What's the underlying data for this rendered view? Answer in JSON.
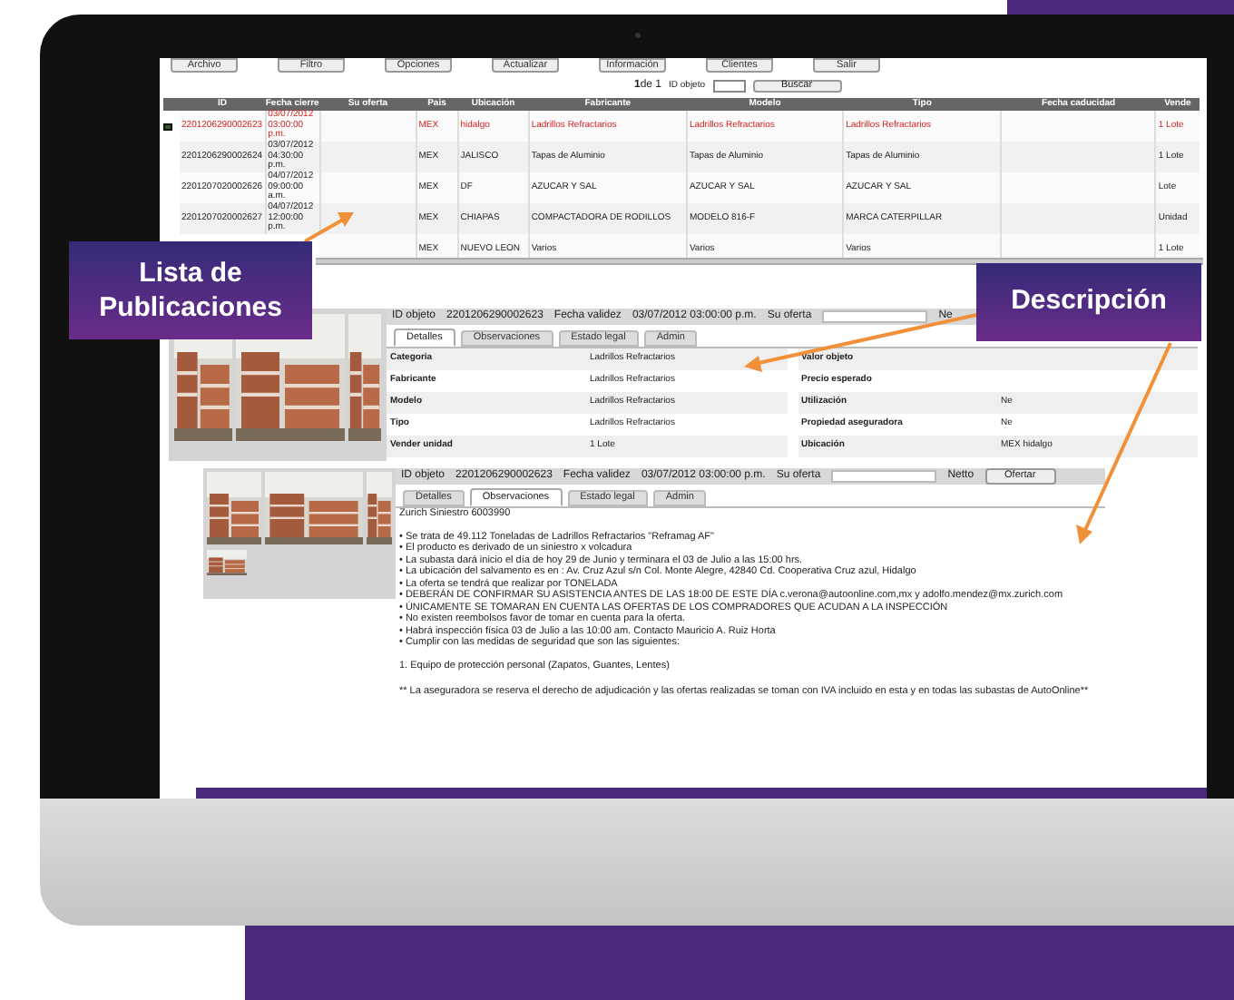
{
  "toolbar": [
    "Archivo",
    "Filtro",
    "Opciones",
    "Actualizar",
    "Información",
    "Clientes",
    "Salir"
  ],
  "pager": {
    "page": "**1**de 1",
    "id_label": "ID objeto",
    "search_button": "Buscar"
  },
  "table": {
    "columns": [
      "ID",
      "Fecha cierre",
      "Su oferta",
      "Pais",
      "Ubicación",
      "Fabricante",
      "Modelo",
      "Tipo",
      "Fecha caducidad",
      "Vende"
    ],
    "rows": [
      {
        "selected": true,
        "id": "2201206290002623",
        "fecha": [
          "03/07/2012",
          "03:00:00",
          "p.m."
        ],
        "pais": "MEX",
        "ubicacion": "hidalgo",
        "fabricante": "Ladrillos Refractarios",
        "modelo": "Ladrillos Refractarios",
        "tipo": "Ladrillos Refractarios",
        "vende": "1 Lote"
      },
      {
        "selected": false,
        "id": "2201206290002624",
        "fecha": [
          "03/07/2012",
          "04:30:00",
          "p.m."
        ],
        "pais": "MEX",
        "ubicacion": "JALISCO",
        "fabricante": "Tapas de Aluminio",
        "modelo": "Tapas de Aluminio",
        "tipo": "Tapas de Aluminio",
        "vende": "1 Lote"
      },
      {
        "selected": false,
        "id": "2201207020002626",
        "fecha": [
          "04/07/2012",
          "09:00:00",
          "a.m."
        ],
        "pais": "MEX",
        "ubicacion": "DF",
        "fabricante": "AZUCAR Y SAL",
        "modelo": "AZUCAR Y SAL",
        "tipo": "AZUCAR Y SAL",
        "vende": "Lote"
      },
      {
        "selected": false,
        "id": "2201207020002627",
        "fecha": [
          "04/07/2012",
          "12:00:00",
          "p.m."
        ],
        "pais": "MEX",
        "ubicacion": "CHIAPAS",
        "fabricante": "COMPACTADORA DE RODILLOS",
        "modelo": "MODELO 816-F",
        "tipo": "MARCA CATERPILLAR",
        "vende": "Unidad"
      },
      {
        "selected": false,
        "pais": "MEX",
        "ubicacion": "NUEVO LEON",
        "fabricante": "Varios",
        "modelo": "Varios",
        "tipo": "Varios",
        "vende": "1 Lote"
      }
    ]
  },
  "callouts": [
    "Lista de Publicaciones",
    "Descripción"
  ],
  "detail": {
    "id_label": "ID objeto",
    "id": "2201206290002623",
    "validez_label": "Fecha validez",
    "validez": "03/07/2012 03:00:00 p.m.",
    "oferta_label": "Su oferta",
    "netto_label": "Ne",
    "tabs": [
      {
        "label": "Detalles",
        "selected": true
      },
      {
        "label": "Observaciones",
        "selected": false
      },
      {
        "label": "Estado legal",
        "selected": false
      },
      {
        "label": "Admin",
        "selected": false
      }
    ],
    "fields_left": [
      {
        "label": "Categoria",
        "value": "Ladrillos Refractarios"
      },
      {
        "label": "Fabricante",
        "value": "Ladrillos Refractarios"
      },
      {
        "label": "Modelo",
        "value": "Ladrillos Refractarios"
      },
      {
        "label": "Tipo",
        "value": "Ladrillos Refractarios"
      },
      {
        "label": "Vender unidad",
        "value": "1 Lote"
      }
    ],
    "fields_right": [
      {
        "label": "Valor objeto"
      },
      {
        "label": "Precio esperado"
      },
      {
        "label": "Utilización",
        "value": "Ne"
      },
      {
        "label": "Propiedad aseguradora",
        "value": "Ne"
      },
      {
        "label": "Ubicación",
        "value": "MEX hidalgo"
      }
    ]
  },
  "observations": {
    "id_label": "ID objeto",
    "id": "2201206290002623",
    "validez_label": "Fecha validez",
    "validez": "03/07/2012 03:00:00 p.m.",
    "oferta_label": "Su oferta",
    "netto_label": "Netto",
    "button": "Ofertar",
    "tabs": [
      {
        "label": "Detalles",
        "selected": false
      },
      {
        "label": "Observaciones",
        "selected": true
      },
      {
        "label": "Estado legal",
        "selected": false
      },
      {
        "label": "Admin",
        "selected": false
      }
    ],
    "title": "Zurich Siniestro 6003990",
    "bullets": [
      "• Se trata de 49.112 Toneladas de Ladrillos Refractarios \"Reframag AF\"",
      "• El producto es derivado de un siniestro x volcadura",
      "• La subasta dará inicio el día de hoy 29 de Junio y terminara el 03 de Julio a las 15:00 hrs.",
      "• La ubicación del salvamento es en : Av. Cruz Azul s/n Col. Monte Alegre, 42840 Cd. Cooperativa Cruz azul, Hidalgo",
      "• La oferta se tendrá que realizar por TONELADA",
      "• DEBERÁN DE CONFIRMAR SU ASISTENCIA ANTES DE LAS 18:00 DE ESTE DÍA c.verona@autoonline.com,mx y adolfo.mendez@mx.zurich.com",
      "• ÚNICAMENTE SE TOMARAN EN CUENTA LAS OFERTAS DE LOS COMPRADORES QUE ACUDAN A LA INSPECCIÓN",
      "• No existen reembolsos favor de tomar en cuenta para la oferta.",
      "• Habrá inspección física 03 de Julio a las 10:00 am. Contacto Mauricio A. Ruiz Horta",
      "• Cumplir con las medidas de seguridad que son las siguientes:"
    ],
    "numbered": "1. Equipo de protección personal (Zapatos, Guantes, Lentes)",
    "footnote": "** La aseguradora se reserva el derecho de adjudicación y las ofertas realizadas se toman con IVA incluido en esta y en todas las subastas de AutoOnline**"
  }
}
